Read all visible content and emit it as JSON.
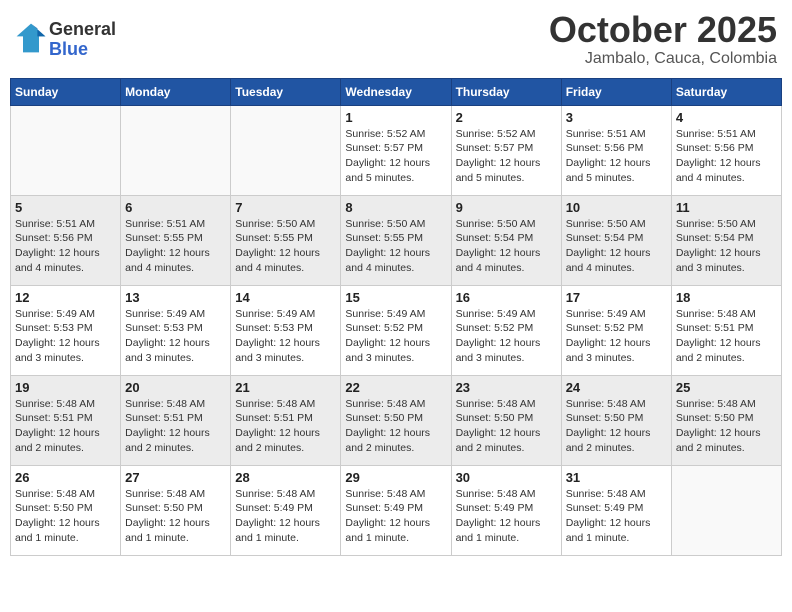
{
  "header": {
    "logo_general": "General",
    "logo_blue": "Blue",
    "month": "October 2025",
    "location": "Jambalo, Cauca, Colombia"
  },
  "weekdays": [
    "Sunday",
    "Monday",
    "Tuesday",
    "Wednesday",
    "Thursday",
    "Friday",
    "Saturday"
  ],
  "weeks": [
    [
      {
        "day": "",
        "info": ""
      },
      {
        "day": "",
        "info": ""
      },
      {
        "day": "",
        "info": ""
      },
      {
        "day": "1",
        "info": "Sunrise: 5:52 AM\nSunset: 5:57 PM\nDaylight: 12 hours\nand 5 minutes."
      },
      {
        "day": "2",
        "info": "Sunrise: 5:52 AM\nSunset: 5:57 PM\nDaylight: 12 hours\nand 5 minutes."
      },
      {
        "day": "3",
        "info": "Sunrise: 5:51 AM\nSunset: 5:56 PM\nDaylight: 12 hours\nand 5 minutes."
      },
      {
        "day": "4",
        "info": "Sunrise: 5:51 AM\nSunset: 5:56 PM\nDaylight: 12 hours\nand 4 minutes."
      }
    ],
    [
      {
        "day": "5",
        "info": "Sunrise: 5:51 AM\nSunset: 5:56 PM\nDaylight: 12 hours\nand 4 minutes."
      },
      {
        "day": "6",
        "info": "Sunrise: 5:51 AM\nSunset: 5:55 PM\nDaylight: 12 hours\nand 4 minutes."
      },
      {
        "day": "7",
        "info": "Sunrise: 5:50 AM\nSunset: 5:55 PM\nDaylight: 12 hours\nand 4 minutes."
      },
      {
        "day": "8",
        "info": "Sunrise: 5:50 AM\nSunset: 5:55 PM\nDaylight: 12 hours\nand 4 minutes."
      },
      {
        "day": "9",
        "info": "Sunrise: 5:50 AM\nSunset: 5:54 PM\nDaylight: 12 hours\nand 4 minutes."
      },
      {
        "day": "10",
        "info": "Sunrise: 5:50 AM\nSunset: 5:54 PM\nDaylight: 12 hours\nand 4 minutes."
      },
      {
        "day": "11",
        "info": "Sunrise: 5:50 AM\nSunset: 5:54 PM\nDaylight: 12 hours\nand 3 minutes."
      }
    ],
    [
      {
        "day": "12",
        "info": "Sunrise: 5:49 AM\nSunset: 5:53 PM\nDaylight: 12 hours\nand 3 minutes."
      },
      {
        "day": "13",
        "info": "Sunrise: 5:49 AM\nSunset: 5:53 PM\nDaylight: 12 hours\nand 3 minutes."
      },
      {
        "day": "14",
        "info": "Sunrise: 5:49 AM\nSunset: 5:53 PM\nDaylight: 12 hours\nand 3 minutes."
      },
      {
        "day": "15",
        "info": "Sunrise: 5:49 AM\nSunset: 5:52 PM\nDaylight: 12 hours\nand 3 minutes."
      },
      {
        "day": "16",
        "info": "Sunrise: 5:49 AM\nSunset: 5:52 PM\nDaylight: 12 hours\nand 3 minutes."
      },
      {
        "day": "17",
        "info": "Sunrise: 5:49 AM\nSunset: 5:52 PM\nDaylight: 12 hours\nand 3 minutes."
      },
      {
        "day": "18",
        "info": "Sunrise: 5:48 AM\nSunset: 5:51 PM\nDaylight: 12 hours\nand 2 minutes."
      }
    ],
    [
      {
        "day": "19",
        "info": "Sunrise: 5:48 AM\nSunset: 5:51 PM\nDaylight: 12 hours\nand 2 minutes."
      },
      {
        "day": "20",
        "info": "Sunrise: 5:48 AM\nSunset: 5:51 PM\nDaylight: 12 hours\nand 2 minutes."
      },
      {
        "day": "21",
        "info": "Sunrise: 5:48 AM\nSunset: 5:51 PM\nDaylight: 12 hours\nand 2 minutes."
      },
      {
        "day": "22",
        "info": "Sunrise: 5:48 AM\nSunset: 5:50 PM\nDaylight: 12 hours\nand 2 minutes."
      },
      {
        "day": "23",
        "info": "Sunrise: 5:48 AM\nSunset: 5:50 PM\nDaylight: 12 hours\nand 2 minutes."
      },
      {
        "day": "24",
        "info": "Sunrise: 5:48 AM\nSunset: 5:50 PM\nDaylight: 12 hours\nand 2 minutes."
      },
      {
        "day": "25",
        "info": "Sunrise: 5:48 AM\nSunset: 5:50 PM\nDaylight: 12 hours\nand 2 minutes."
      }
    ],
    [
      {
        "day": "26",
        "info": "Sunrise: 5:48 AM\nSunset: 5:50 PM\nDaylight: 12 hours\nand 1 minute."
      },
      {
        "day": "27",
        "info": "Sunrise: 5:48 AM\nSunset: 5:50 PM\nDaylight: 12 hours\nand 1 minute."
      },
      {
        "day": "28",
        "info": "Sunrise: 5:48 AM\nSunset: 5:49 PM\nDaylight: 12 hours\nand 1 minute."
      },
      {
        "day": "29",
        "info": "Sunrise: 5:48 AM\nSunset: 5:49 PM\nDaylight: 12 hours\nand 1 minute."
      },
      {
        "day": "30",
        "info": "Sunrise: 5:48 AM\nSunset: 5:49 PM\nDaylight: 12 hours\nand 1 minute."
      },
      {
        "day": "31",
        "info": "Sunrise: 5:48 AM\nSunset: 5:49 PM\nDaylight: 12 hours\nand 1 minute."
      },
      {
        "day": "",
        "info": ""
      }
    ]
  ]
}
